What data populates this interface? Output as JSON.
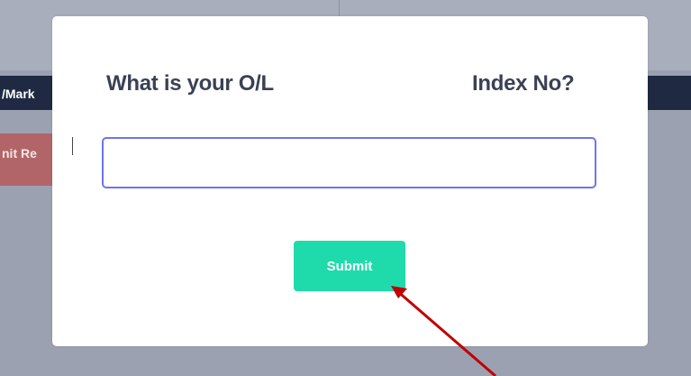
{
  "background": {
    "nav_text": "/Mark",
    "red_button_label": "nit Re"
  },
  "modal": {
    "title_left": "What is your O/L",
    "title_right": "Index No?",
    "input_value": "",
    "input_placeholder": "",
    "submit_label": "Submit"
  },
  "colors": {
    "accent": "#1fdbab",
    "title_text": "#3a4154",
    "input_border": "#6e74f0",
    "annotation_arrow": "#c00000",
    "nav_background": "#1f2a42"
  },
  "annotation": {
    "type": "arrow",
    "target": "submit-button"
  }
}
